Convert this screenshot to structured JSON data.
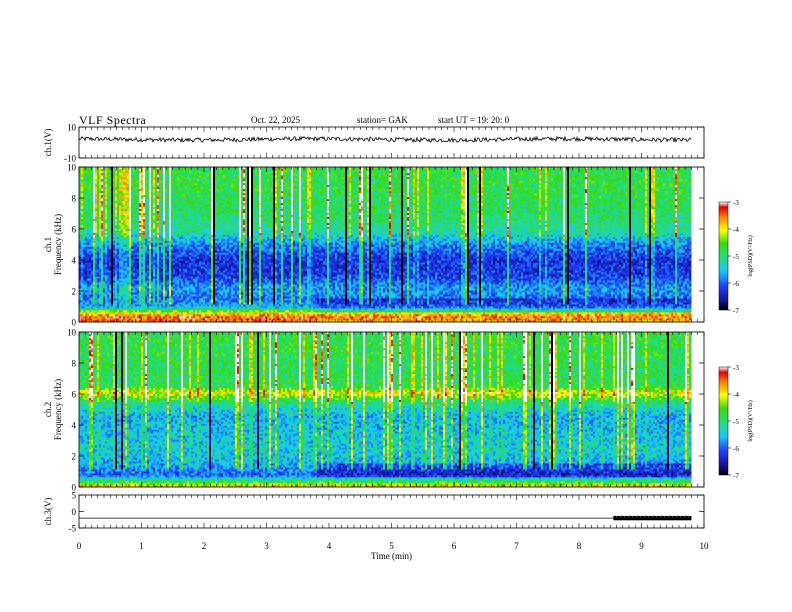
{
  "header": {
    "title": "VLF  Spectra",
    "date": "Oct. 22, 2025",
    "station": "station= GAK",
    "start": "start  UT  =    19: 20: 0"
  },
  "chart_data": [
    {
      "type": "line",
      "name": "channel-1-waveform",
      "ylabel": "ch.1(V)",
      "yticks": [
        "10",
        "-10"
      ],
      "ylim": [
        -10,
        10
      ],
      "xlim": [
        0,
        10
      ],
      "trace": {
        "approx_level": 2,
        "amplitude": 2,
        "end_min": 9.8
      }
    },
    {
      "type": "heatmap",
      "name": "channel-1-spectrogram",
      "ylabel": "ch.1\nFrequency  (kHz)",
      "yticks": [
        "0",
        "2",
        "4",
        "6",
        "8",
        "10"
      ],
      "ylim": [
        0,
        10
      ],
      "xlim": [
        0,
        10
      ],
      "data_end_min": 9.8,
      "colorbar": {
        "label": "log(PSD)(V²/Hz)",
        "ticks": [
          "-3",
          "-4",
          "-5",
          "-6",
          "-7"
        ],
        "range": [
          -7,
          -3
        ]
      },
      "profile_khz": [
        [
          0,
          -3.5
        ],
        [
          0.3,
          -3.4
        ],
        [
          0.6,
          -4.0
        ],
        [
          1.0,
          -5.6
        ],
        [
          1.5,
          -5.9
        ],
        [
          2.2,
          -5.7
        ],
        [
          3.0,
          -6.2
        ],
        [
          4.0,
          -6.3
        ],
        [
          5.0,
          -5.8
        ],
        [
          5.8,
          -5.2
        ],
        [
          6.5,
          -5.0
        ],
        [
          7.5,
          -4.9
        ],
        [
          8.5,
          -4.8
        ],
        [
          10,
          -4.8
        ]
      ],
      "change_min": 3.8
    },
    {
      "type": "heatmap",
      "name": "channel-2-spectrogram",
      "ylabel": "ch.2\nFrequency  (kHz)",
      "yticks": [
        "0",
        "2",
        "4",
        "6",
        "8",
        "10"
      ],
      "ylim": [
        0,
        10
      ],
      "xlim": [
        0,
        10
      ],
      "data_end_min": 9.8,
      "colorbar": {
        "label": "log(PSD)(V²/Hz)",
        "ticks": [
          "-3",
          "-4",
          "-5",
          "-6",
          "-7"
        ],
        "range": [
          -7,
          -3
        ]
      },
      "profile_khz": [
        [
          0,
          -3.6
        ],
        [
          0.3,
          -4.6
        ],
        [
          0.8,
          -6.0
        ],
        [
          1.5,
          -5.6
        ],
        [
          2.5,
          -5.4
        ],
        [
          3.5,
          -5.5
        ],
        [
          4.5,
          -5.6
        ],
        [
          5.3,
          -5.2
        ],
        [
          5.9,
          -4.4
        ],
        [
          6.1,
          -4.1
        ],
        [
          6.5,
          -4.8
        ],
        [
          7.5,
          -4.9
        ],
        [
          8.5,
          -4.8
        ],
        [
          10,
          -4.8
        ]
      ],
      "change_min": 3.8
    },
    {
      "type": "line",
      "name": "channel-3-waveform",
      "ylabel": "ch.3(V)",
      "yticks": [
        "5",
        "0",
        "-5"
      ],
      "ylim": [
        -5,
        5
      ],
      "xlim": [
        0,
        10
      ],
      "trace": {
        "approx_level": -2,
        "thick_from_min": 8.55,
        "end_min": 9.8
      }
    }
  ],
  "xaxis": {
    "label": "Time  (min)",
    "ticks": [
      "0",
      "1",
      "2",
      "3",
      "4",
      "5",
      "6",
      "7",
      "8",
      "9",
      "10"
    ],
    "xlim": [
      0,
      10
    ]
  }
}
